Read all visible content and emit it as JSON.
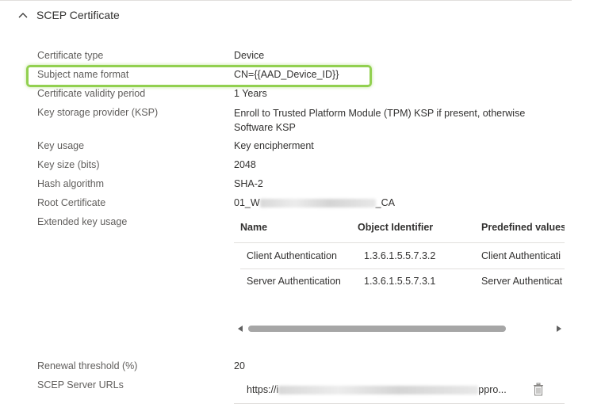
{
  "section": {
    "title": "SCEP Certificate"
  },
  "properties": [
    {
      "label": "Certificate type",
      "value": "Device"
    },
    {
      "label": "Subject name format",
      "value": "CN={{AAD_Device_ID}}"
    },
    {
      "label": "Certificate validity period",
      "value": "1 Years"
    },
    {
      "label": "Key storage provider (KSP)",
      "value": "Enroll to Trusted Platform Module (TPM) KSP if present, otherwise Software KSP"
    },
    {
      "label": "Key usage",
      "value": "Key encipherment"
    },
    {
      "label": "Key size (bits)",
      "value": "2048"
    },
    {
      "label": "Hash algorithm",
      "value": "SHA-2"
    },
    {
      "label": "Root Certificate",
      "value_prefix": "01_W",
      "value_suffix": "_CA"
    },
    {
      "label": "Extended key usage"
    }
  ],
  "eku": {
    "columns": [
      "Name",
      "Object Identifier",
      "Predefined values"
    ],
    "rows": [
      [
        "Client Authentication",
        "1.3.6.1.5.5.7.3.2",
        "Client Authenticati"
      ],
      [
        "Server Authentication",
        "1.3.6.1.5.5.7.3.1",
        "Server Authenticat"
      ]
    ]
  },
  "renewal": {
    "label": "Renewal threshold (%)",
    "value": "20"
  },
  "scep_urls": {
    "label": "SCEP Server URLs",
    "url_prefix": "https://i",
    "url_suffix": "ppro..."
  },
  "colors": {
    "highlight": "#92d050",
    "label_text": "#605e5c",
    "value_text": "#323130"
  },
  "icons": {
    "collapse": "chevron-up-icon",
    "delete": "trash-icon"
  }
}
